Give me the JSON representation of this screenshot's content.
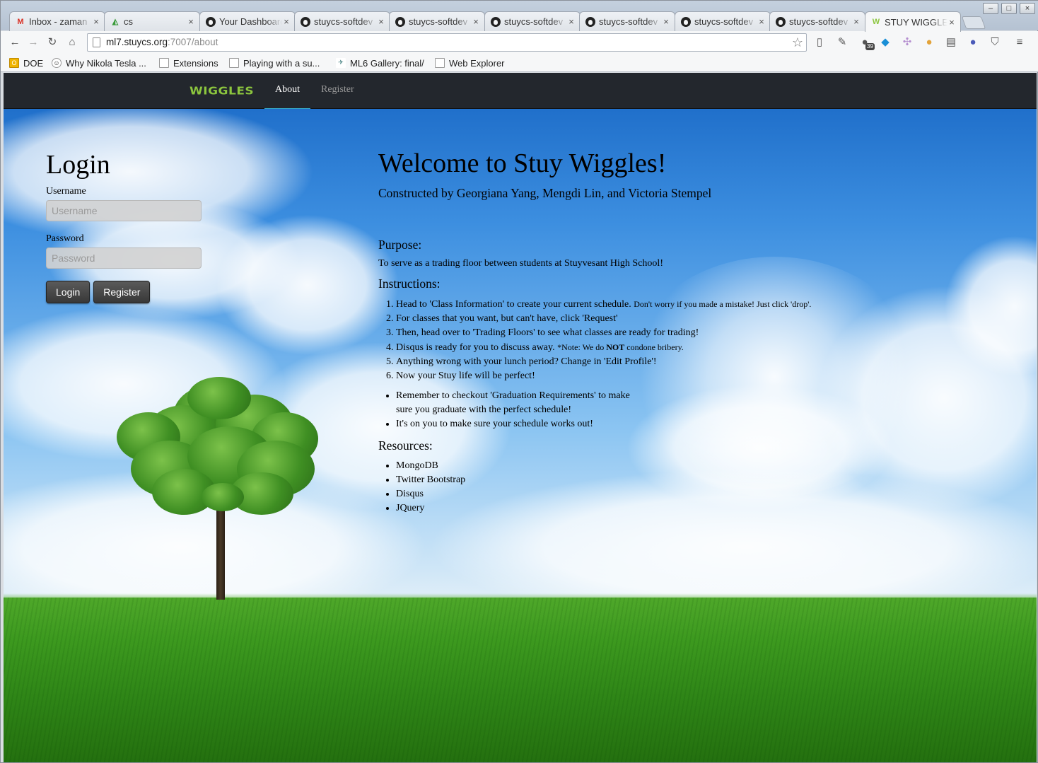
{
  "browser": {
    "tabs": [
      {
        "title": "Inbox - zaman",
        "icon": "gmail-icon"
      },
      {
        "title": "cs",
        "icon": "drive-icon"
      },
      {
        "title": "Your Dashboard",
        "icon": "github-icon"
      },
      {
        "title": "stuycs-softdev",
        "icon": "github-icon"
      },
      {
        "title": "stuycs-softdev",
        "icon": "github-icon"
      },
      {
        "title": "stuycs-softdev",
        "icon": "github-icon"
      },
      {
        "title": "stuycs-softdev",
        "icon": "github-icon"
      },
      {
        "title": "stuycs-softdev",
        "icon": "github-icon"
      },
      {
        "title": "stuycs-softdev",
        "icon": "github-icon"
      },
      {
        "title": "STUY WIGGLES",
        "icon": "wiggles-icon"
      }
    ],
    "url_host": "ml7.stuycs.org",
    "url_rest": ":7007/about",
    "extension_badge": "39",
    "bookmarks": [
      "DOE",
      "Why Nikola Tesla ...",
      "Extensions",
      "Playing with a su...",
      "ML6 Gallery: final/",
      "Web Explorer"
    ]
  },
  "navbar": {
    "brand": "WIGGLES",
    "items": [
      "About",
      "Register"
    ],
    "active_item": "About"
  },
  "login": {
    "title": "Login",
    "username_label": "Username",
    "username_placeholder": "Username",
    "password_label": "Password",
    "password_placeholder": "Password",
    "login_button": "Login",
    "register_button": "Register"
  },
  "about": {
    "title": "Welcome to Stuy Wiggles!",
    "credits": "Constructed by Georgiana Yang, Mengdi Lin, and Victoria Stempel",
    "purpose_heading": "Purpose:",
    "purpose_text": "To serve as a trading floor between students at Stuyvesant High School!",
    "instructions_heading": "Instructions:",
    "steps": [
      {
        "text": "Head to 'Class Information' to create your current schedule.",
        "note": "Don't worry if you made a mistake! Just click 'drop'."
      },
      {
        "text": "For classes that you want, but can't have, click 'Request'"
      },
      {
        "text": "Then, head over to 'Trading Floors' to see what classes are ready for trading!"
      },
      {
        "text": "Disqus is ready for you to discuss away.",
        "note_pre": "*Note: We do",
        "note_bold": "NOT",
        "note_post": "condone bribery."
      },
      {
        "text": "Anything wrong with your lunch period? Change in 'Edit Profile'!"
      },
      {
        "text": "Now your Stuy life will be perfect!"
      }
    ],
    "tips": [
      "Remember to checkout 'Graduation Requirements' to make sure you graduate with the perfect schedule!",
      "It's on you to make sure your schedule works out!"
    ],
    "resources_heading": "Resources:",
    "resources": [
      "MongoDB",
      "Twitter Bootstrap",
      "Disqus",
      "JQuery"
    ]
  },
  "colors": {
    "navbar_bg": "#23272d",
    "brand": "#8cc63e",
    "nav_active_underline": "#35a9c9"
  }
}
